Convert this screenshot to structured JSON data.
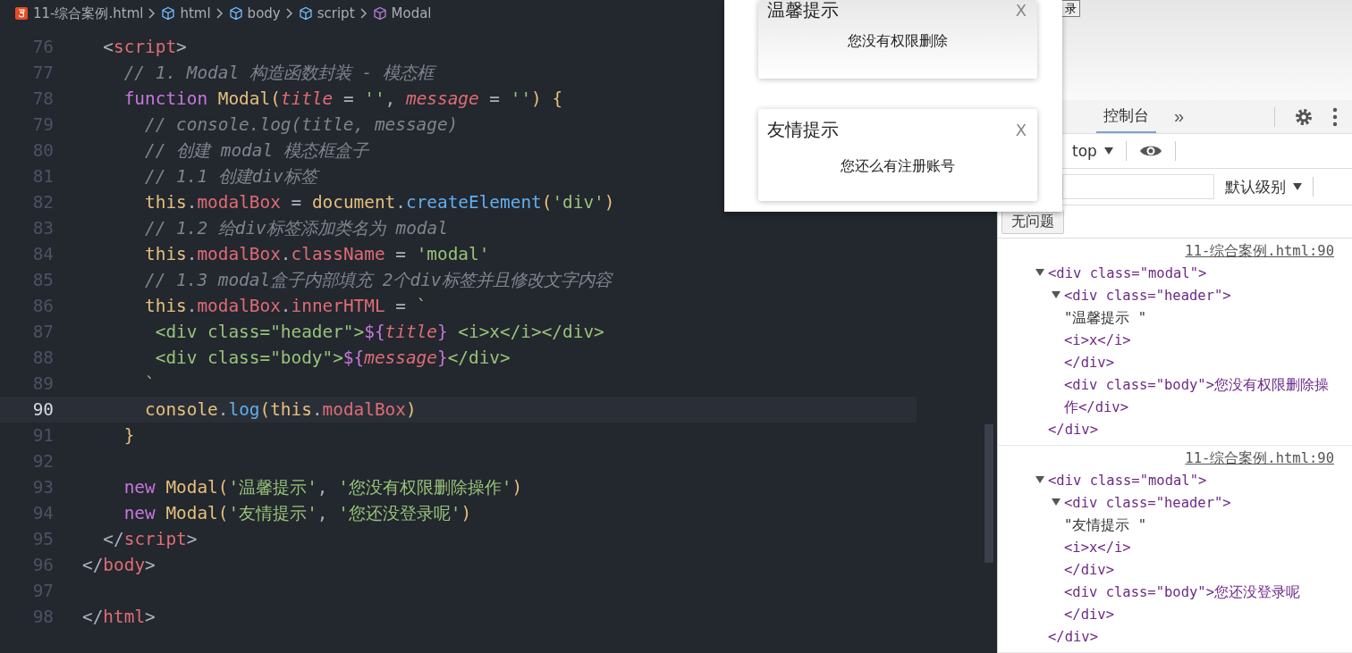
{
  "breadcrumb": [
    {
      "label": "11-综合案例.html",
      "kind": "file"
    },
    {
      "label": "html",
      "kind": "element"
    },
    {
      "label": "body",
      "kind": "element"
    },
    {
      "label": "script",
      "kind": "element"
    },
    {
      "label": "Modal",
      "kind": "method"
    }
  ],
  "code": [
    {
      "number": "76",
      "tokens": [
        {
          "text": "  <",
          "kind": "p"
        },
        {
          "text": "script",
          "kind": "tag"
        },
        {
          "text": ">",
          "kind": "p"
        }
      ]
    },
    {
      "number": "77",
      "tokens": [
        {
          "text": "    // 1. Modal 构造函数封装 - 模态框",
          "kind": "cm"
        }
      ]
    },
    {
      "number": "78",
      "tokens": [
        {
          "text": "    function ",
          "kind": "kw"
        },
        {
          "text": "Modal",
          "kind": "fn"
        },
        {
          "text": "(",
          "kind": "br"
        },
        {
          "text": "title",
          "kind": "param"
        },
        {
          "text": " = ",
          "kind": "p"
        },
        {
          "text": "''",
          "kind": "str"
        },
        {
          "text": ", ",
          "kind": "p"
        },
        {
          "text": "message",
          "kind": "param"
        },
        {
          "text": " = ",
          "kind": "p"
        },
        {
          "text": "''",
          "kind": "str"
        },
        {
          "text": ") ",
          "kind": "br"
        },
        {
          "text": "{",
          "kind": "br"
        }
      ]
    },
    {
      "number": "79",
      "tokens": [
        {
          "text": "      // console.log(title, message)",
          "kind": "cm"
        }
      ]
    },
    {
      "number": "80",
      "tokens": [
        {
          "text": "      // 创建 modal 模态框盒子",
          "kind": "cm"
        }
      ]
    },
    {
      "number": "81",
      "tokens": [
        {
          "text": "      // 1.1 创建div标签",
          "kind": "cm"
        }
      ]
    },
    {
      "number": "82",
      "tokens": [
        {
          "text": "      this",
          "kind": "obj"
        },
        {
          "text": ".",
          "kind": "p"
        },
        {
          "text": "modalBox",
          "kind": "prop"
        },
        {
          "text": " = ",
          "kind": "p"
        },
        {
          "text": "document",
          "kind": "obj"
        },
        {
          "text": ".",
          "kind": "p"
        },
        {
          "text": "createElement",
          "kind": "method"
        },
        {
          "text": "(",
          "kind": "br"
        },
        {
          "text": "'div'",
          "kind": "str"
        },
        {
          "text": ")",
          "kind": "br"
        }
      ]
    },
    {
      "number": "83",
      "tokens": [
        {
          "text": "      // 1.2 给div标签添加类名为 modal",
          "kind": "cm"
        }
      ]
    },
    {
      "number": "84",
      "tokens": [
        {
          "text": "      this",
          "kind": "obj"
        },
        {
          "text": ".",
          "kind": "p"
        },
        {
          "text": "modalBox",
          "kind": "prop"
        },
        {
          "text": ".",
          "kind": "p"
        },
        {
          "text": "className",
          "kind": "prop"
        },
        {
          "text": " = ",
          "kind": "p"
        },
        {
          "text": "'modal'",
          "kind": "str"
        }
      ]
    },
    {
      "number": "85",
      "tokens": [
        {
          "text": "      // 1.3 modal盒子内部填充 2个div标签并且修改文字内容",
          "kind": "cm"
        }
      ]
    },
    {
      "number": "86",
      "tokens": [
        {
          "text": "      this",
          "kind": "obj"
        },
        {
          "text": ".",
          "kind": "p"
        },
        {
          "text": "modalBox",
          "kind": "prop"
        },
        {
          "text": ".",
          "kind": "p"
        },
        {
          "text": "innerHTML",
          "kind": "prop"
        },
        {
          "text": " = ",
          "kind": "p"
        },
        {
          "text": "`",
          "kind": "str"
        }
      ]
    },
    {
      "number": "87",
      "tokens": [
        {
          "text": "       <div class=\"header\">",
          "kind": "str"
        },
        {
          "text": "${",
          "kind": "interp"
        },
        {
          "text": "title",
          "kind": "param"
        },
        {
          "text": "}",
          "kind": "interp"
        },
        {
          "text": " <i>x</i></div>",
          "kind": "str"
        }
      ]
    },
    {
      "number": "88",
      "tokens": [
        {
          "text": "       <div class=\"body\">",
          "kind": "str"
        },
        {
          "text": "${",
          "kind": "interp"
        },
        {
          "text": "message",
          "kind": "param"
        },
        {
          "text": "}",
          "kind": "interp"
        },
        {
          "text": "</div>",
          "kind": "str"
        }
      ]
    },
    {
      "number": "89",
      "tokens": [
        {
          "text": "      `",
          "kind": "str"
        }
      ]
    },
    {
      "number": "90",
      "current": true,
      "tokens": [
        {
          "text": "      console",
          "kind": "obj"
        },
        {
          "text": ".",
          "kind": "p"
        },
        {
          "text": "log",
          "kind": "method"
        },
        {
          "text": "(",
          "kind": "br"
        },
        {
          "text": "this",
          "kind": "obj"
        },
        {
          "text": ".",
          "kind": "p"
        },
        {
          "text": "modalBox",
          "kind": "prop"
        },
        {
          "text": ")",
          "kind": "br"
        }
      ]
    },
    {
      "number": "91",
      "tokens": [
        {
          "text": "    }",
          "kind": "br"
        }
      ]
    },
    {
      "number": "92"
    },
    {
      "number": "93",
      "tokens": [
        {
          "text": "    new ",
          "kind": "kw"
        },
        {
          "text": "Modal",
          "kind": "fn"
        },
        {
          "text": "(",
          "kind": "br"
        },
        {
          "text": "'温馨提示'",
          "kind": "str"
        },
        {
          "text": ", ",
          "kind": "p"
        },
        {
          "text": "'您没有权限删除操作'",
          "kind": "str"
        },
        {
          "text": ")",
          "kind": "br"
        }
      ]
    },
    {
      "number": "94",
      "tokens": [
        {
          "text": "    new ",
          "kind": "kw"
        },
        {
          "text": "Modal",
          "kind": "fn"
        },
        {
          "text": "(",
          "kind": "br"
        },
        {
          "text": "'友情提示'",
          "kind": "str"
        },
        {
          "text": ", ",
          "kind": "p"
        },
        {
          "text": "'您还没登录呢'",
          "kind": "str"
        },
        {
          "text": ")",
          "kind": "br"
        }
      ]
    },
    {
      "number": "95",
      "tokens": [
        {
          "text": "  </",
          "kind": "p"
        },
        {
          "text": "script",
          "kind": "tag"
        },
        {
          "text": ">",
          "kind": "p"
        }
      ]
    },
    {
      "number": "96",
      "tokens": [
        {
          "text": "</",
          "kind": "p"
        },
        {
          "text": "body",
          "kind": "tag"
        },
        {
          "text": ">",
          "kind": "p"
        }
      ]
    },
    {
      "number": "97"
    },
    {
      "number": "98",
      "tokens": [
        {
          "text": "</",
          "kind": "p"
        },
        {
          "text": "html",
          "kind": "tag"
        },
        {
          "text": ">",
          "kind": "p"
        }
      ]
    }
  ],
  "page_button": "录",
  "modals": [
    {
      "title": "温馨提示",
      "close": "X",
      "message": "您没有权限删除"
    },
    {
      "title": "友情提示",
      "close": "X",
      "message": "您还么有注册账号"
    }
  ],
  "devtools": {
    "tabs": [
      {
        "label": "控制台",
        "selected": true
      }
    ],
    "more": "»",
    "context": "top",
    "levels": "默认级别",
    "issues": "无问题",
    "messages": [
      {
        "source": "11-综合案例.html:90",
        "node": {
          "text": "<div class=\"modal\">",
          "kind": "tag",
          "expanded": true,
          "close": "</div>",
          "children": [
            {
              "text": "<div class=\"header\">",
              "kind": "tag",
              "expanded": true,
              "close": "</div>",
              "children": [
                {
                  "text": "\"温馨提示 \"",
                  "kind": "text"
                },
                {
                  "text": "<i>x</i>",
                  "kind": "tag"
                }
              ]
            },
            {
              "text": "<div class=\"body\">您没有权限删除操作</div>",
              "kind": "tag"
            }
          ]
        }
      },
      {
        "source": "11-综合案例.html:90",
        "node": {
          "text": "<div class=\"modal\">",
          "kind": "tag",
          "expanded": true,
          "close": "</div>",
          "children": [
            {
              "text": "<div class=\"header\">",
              "kind": "tag",
              "expanded": true,
              "close": "</div>",
              "children": [
                {
                  "text": "\"友情提示 \"",
                  "kind": "text"
                },
                {
                  "text": "<i>x</i>",
                  "kind": "tag"
                }
              ]
            },
            {
              "text": "<div class=\"body\">您还没登录呢</div>",
              "kind": "tag"
            }
          ]
        }
      }
    ]
  }
}
